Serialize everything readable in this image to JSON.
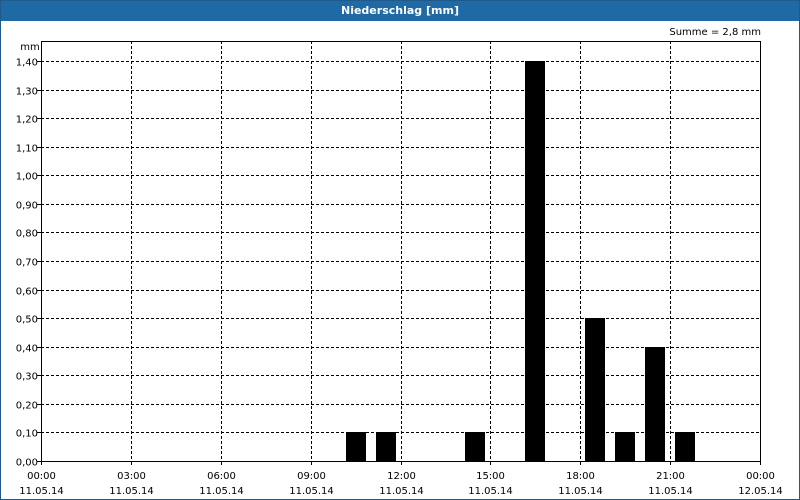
{
  "title": "Niederschlag [mm]",
  "summary": "Summe = 2,8 mm",
  "colors": {
    "titlebar": "#1f6aa5",
    "bar": "#000000",
    "grid": "#000000"
  },
  "chart_data": {
    "type": "bar",
    "title": "Niederschlag [mm]",
    "ylabel": "mm",
    "ylim": [
      0,
      1.4
    ],
    "y_ticks": [
      "0,00",
      "0,10",
      "0,20",
      "0,30",
      "0,40",
      "0,50",
      "0,60",
      "0,70",
      "0,80",
      "0,90",
      "1,00",
      "1,10",
      "1,20",
      "1,30",
      "1,40"
    ],
    "xlim": [
      "11.05.14 00:00",
      "12.05.14 00:00"
    ],
    "x_ticks": [
      {
        "time": "00:00",
        "date": "11.05.14"
      },
      {
        "time": "03:00",
        "date": "11.05.14"
      },
      {
        "time": "06:00",
        "date": "11.05.14"
      },
      {
        "time": "09:00",
        "date": "11.05.14"
      },
      {
        "time": "12:00",
        "date": "11.05.14"
      },
      {
        "time": "15:00",
        "date": "11.05.14"
      },
      {
        "time": "18:00",
        "date": "11.05.14"
      },
      {
        "time": "21:00",
        "date": "11.05.14"
      },
      {
        "time": "00:00",
        "date": "12.05.14"
      }
    ],
    "bars": [
      {
        "x": "11.05.14 10:30",
        "value": 0.1
      },
      {
        "x": "11.05.14 11:30",
        "value": 0.1
      },
      {
        "x": "11.05.14 14:30",
        "value": 0.1
      },
      {
        "x": "11.05.14 16:30",
        "value": 1.4
      },
      {
        "x": "11.05.14 18:30",
        "value": 0.5
      },
      {
        "x": "11.05.14 19:30",
        "value": 0.1
      },
      {
        "x": "11.05.14 20:30",
        "value": 0.4
      },
      {
        "x": "11.05.14 21:30",
        "value": 0.1
      }
    ],
    "grid": true
  }
}
